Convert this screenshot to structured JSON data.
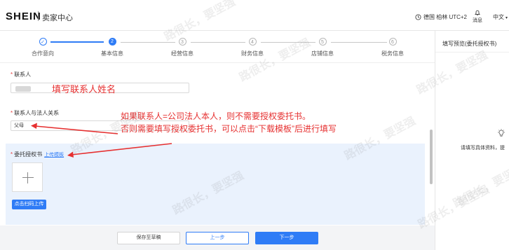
{
  "header": {
    "logo": "SHEIN",
    "subtitle": "卖家中心",
    "timezone": "德国 柏林 UTC+2",
    "message_label": "消息",
    "language": "中文"
  },
  "steps": [
    {
      "label": "合作意向",
      "marker": "✓",
      "state": "done"
    },
    {
      "label": "基本信息",
      "marker": "2",
      "state": "current"
    },
    {
      "label": "经营信息",
      "marker": "3",
      "state": "todo"
    },
    {
      "label": "财务信息",
      "marker": "4",
      "state": "todo"
    },
    {
      "label": "店铺信息",
      "marker": "5",
      "state": "todo"
    },
    {
      "label": "税务信息",
      "marker": "6",
      "state": "todo"
    }
  ],
  "form": {
    "contact_label": "联系人",
    "relation_label": "联系人与法人关系",
    "relation_value": "父母",
    "authorization_label": "委托授权书",
    "upload_template_link": "上传模板",
    "scan_upload_button": "点击扫码上传"
  },
  "annotations": {
    "contact_hint": "填写联系人姓名",
    "authorization_hint_line1": "如果联系人=公司法人本人，则不需要授权委托书。",
    "authorization_hint_line2": "否则需要填写授权委托书，可以点击“下载模板”后进行填写"
  },
  "footer": {
    "save_draft": "保存至草稿",
    "prev": "上一步",
    "next": "下一步"
  },
  "preview": {
    "title": "填写预览(委托授权书)",
    "hint": "请填写具体资料，提"
  },
  "watermark": "路很长，要坚强",
  "colors": {
    "accent": "#2f7cf6",
    "annotation": "#e63030",
    "panel_bg": "#eaf2fd"
  }
}
